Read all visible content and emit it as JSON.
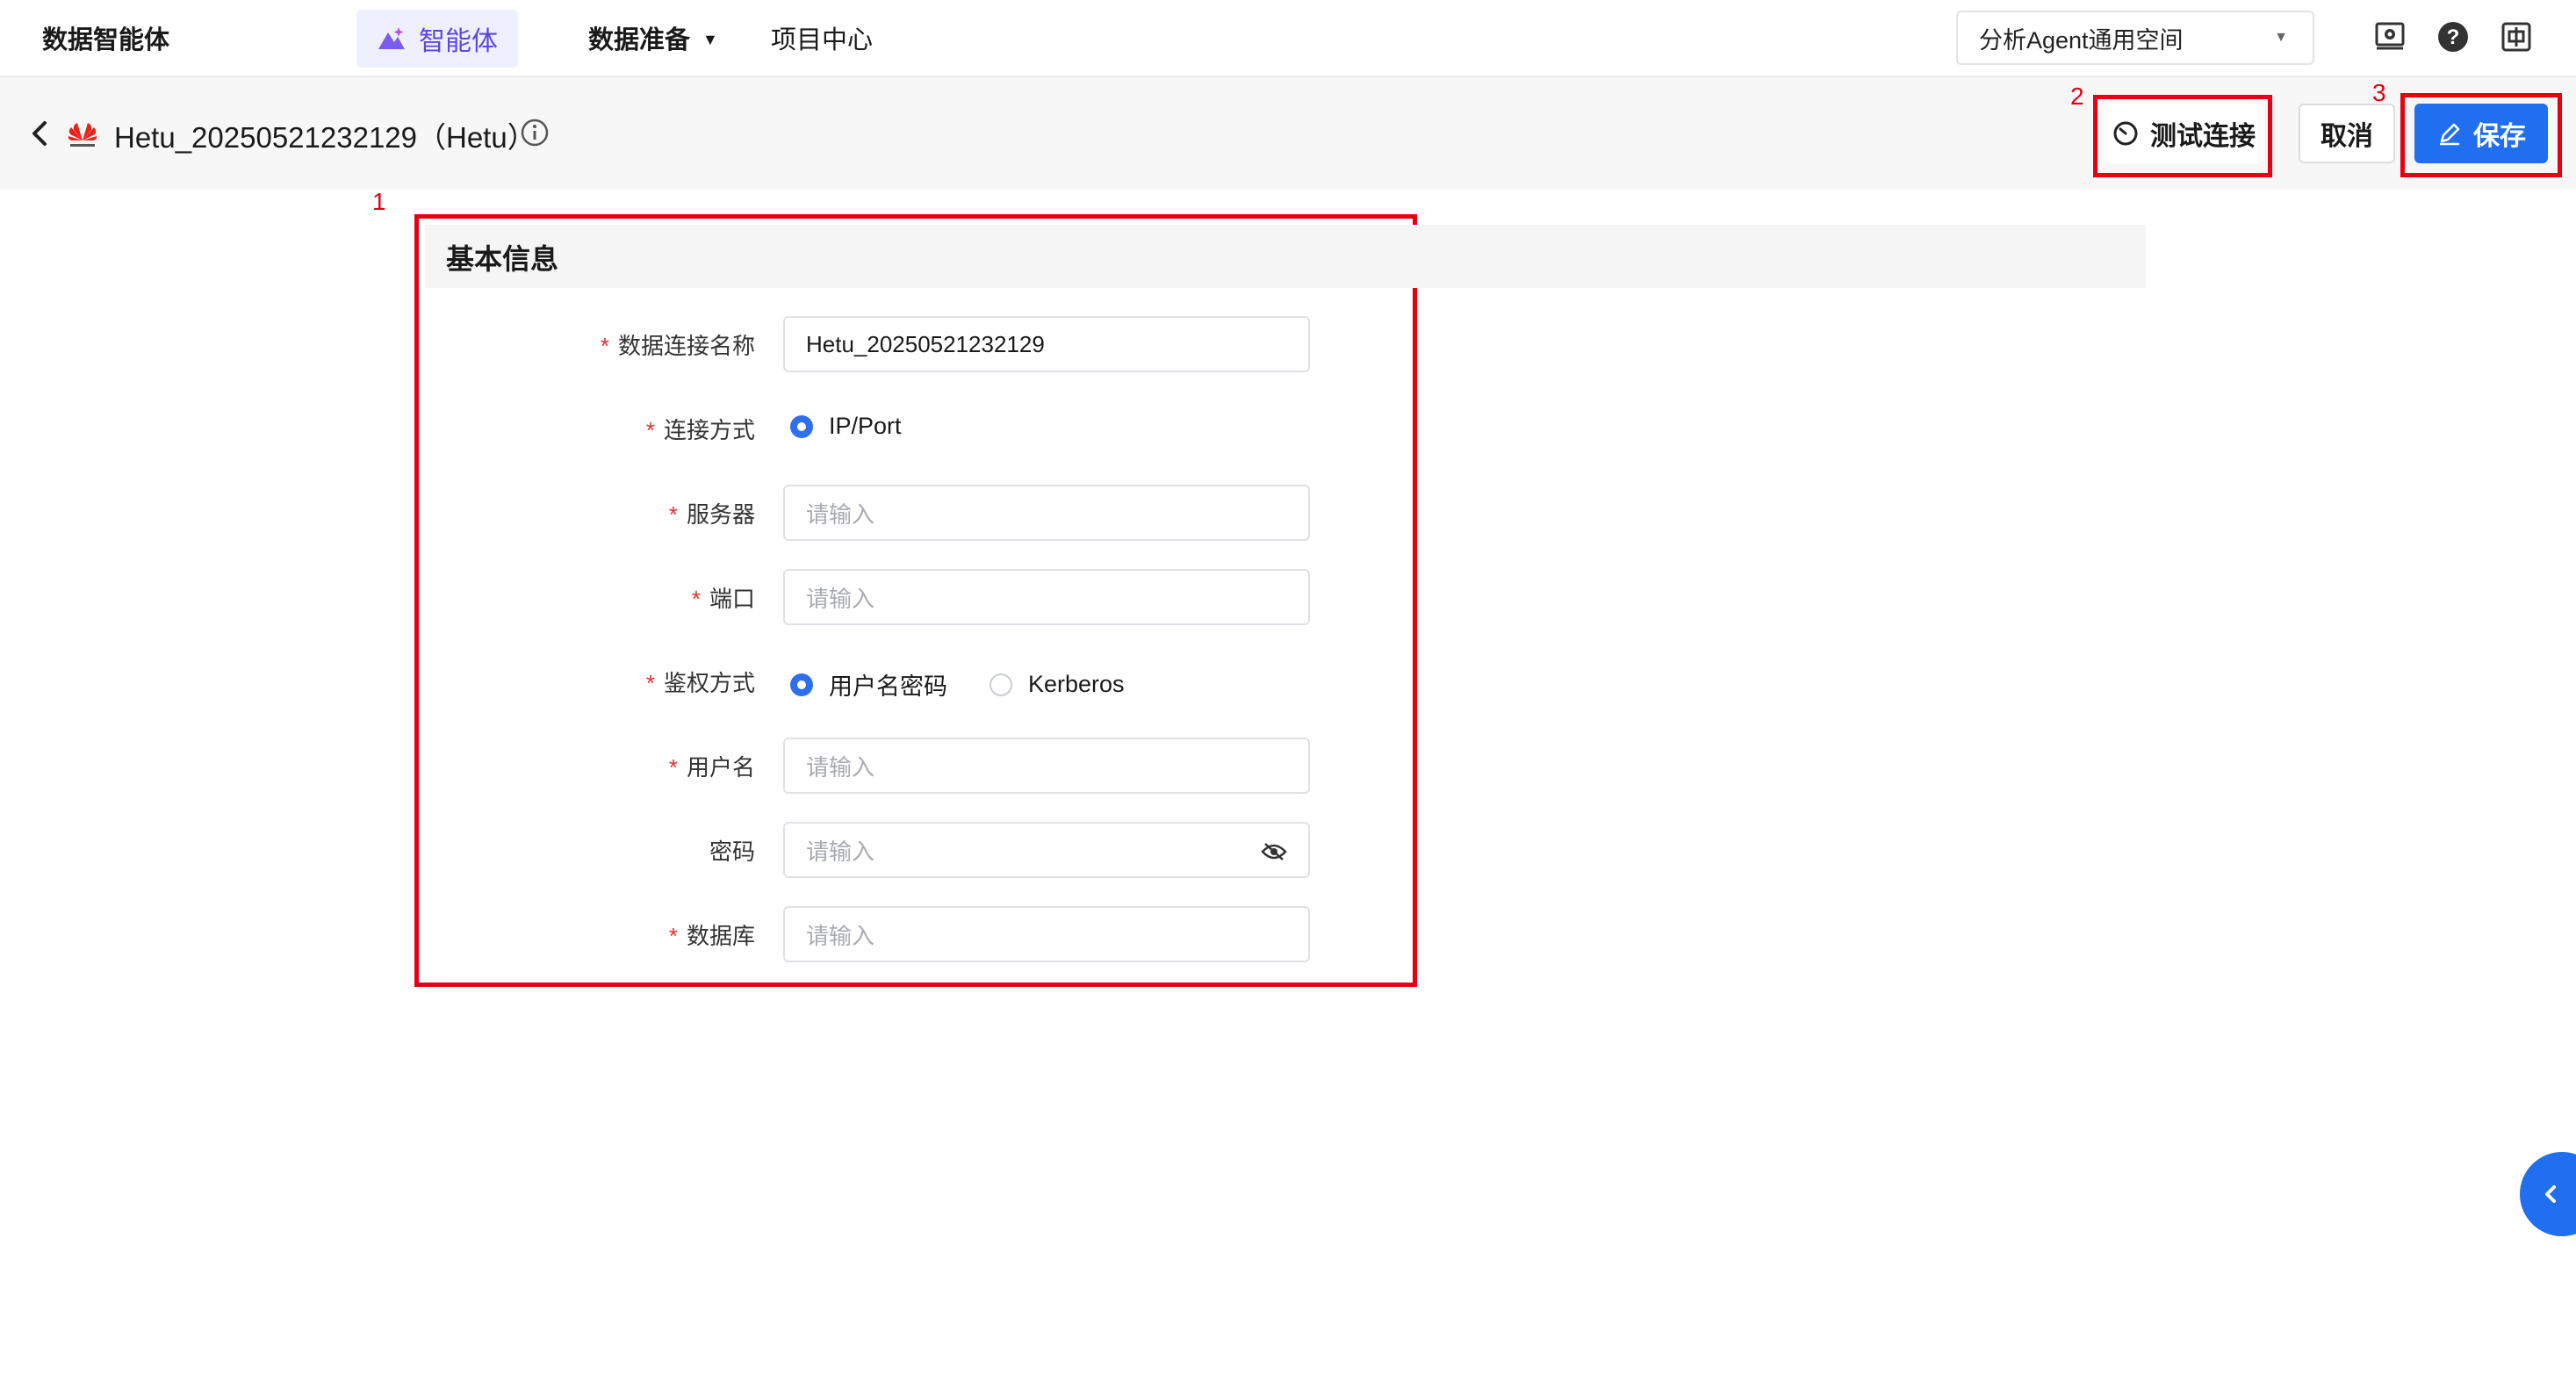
{
  "nav": {
    "brand": "数据智能体",
    "active_item": "智能体",
    "data_prep": "数据准备",
    "project_center": "项目中心",
    "workspace": "分析Agent通用空间",
    "icons": [
      "settings-screen-icon",
      "help-icon",
      "language-zh-icon"
    ]
  },
  "header": {
    "title": "Hetu_20250521232129（Hetu）",
    "test_connection": "测试连接",
    "cancel": "取消",
    "save": "保存"
  },
  "annotations": [
    "1",
    "2",
    "3"
  ],
  "form": {
    "section_title": "基本信息",
    "fields": {
      "name": {
        "label": "数据连接名称",
        "required": true,
        "value": "Hetu_20250521232129"
      },
      "conn_mode": {
        "label": "连接方式",
        "required": true,
        "option": "IP/Port"
      },
      "server": {
        "label": "服务器",
        "required": true,
        "placeholder": "请输入"
      },
      "port": {
        "label": "端口",
        "required": true,
        "placeholder": "请输入"
      },
      "auth": {
        "label": "鉴权方式",
        "required": true,
        "option_1": "用户名密码",
        "option_2": "Kerberos",
        "selected": "用户名密码"
      },
      "username": {
        "label": "用户名",
        "required": true,
        "placeholder": "请输入"
      },
      "password": {
        "label": "密码",
        "required": false,
        "placeholder": "请输入"
      },
      "database": {
        "label": "数据库",
        "required": true,
        "placeholder": "请输入"
      }
    }
  },
  "colors": {
    "primary": "#1f6ff0",
    "annotation": "#e60012",
    "required": "#e0312d",
    "active_nav": "#5b47e0"
  }
}
